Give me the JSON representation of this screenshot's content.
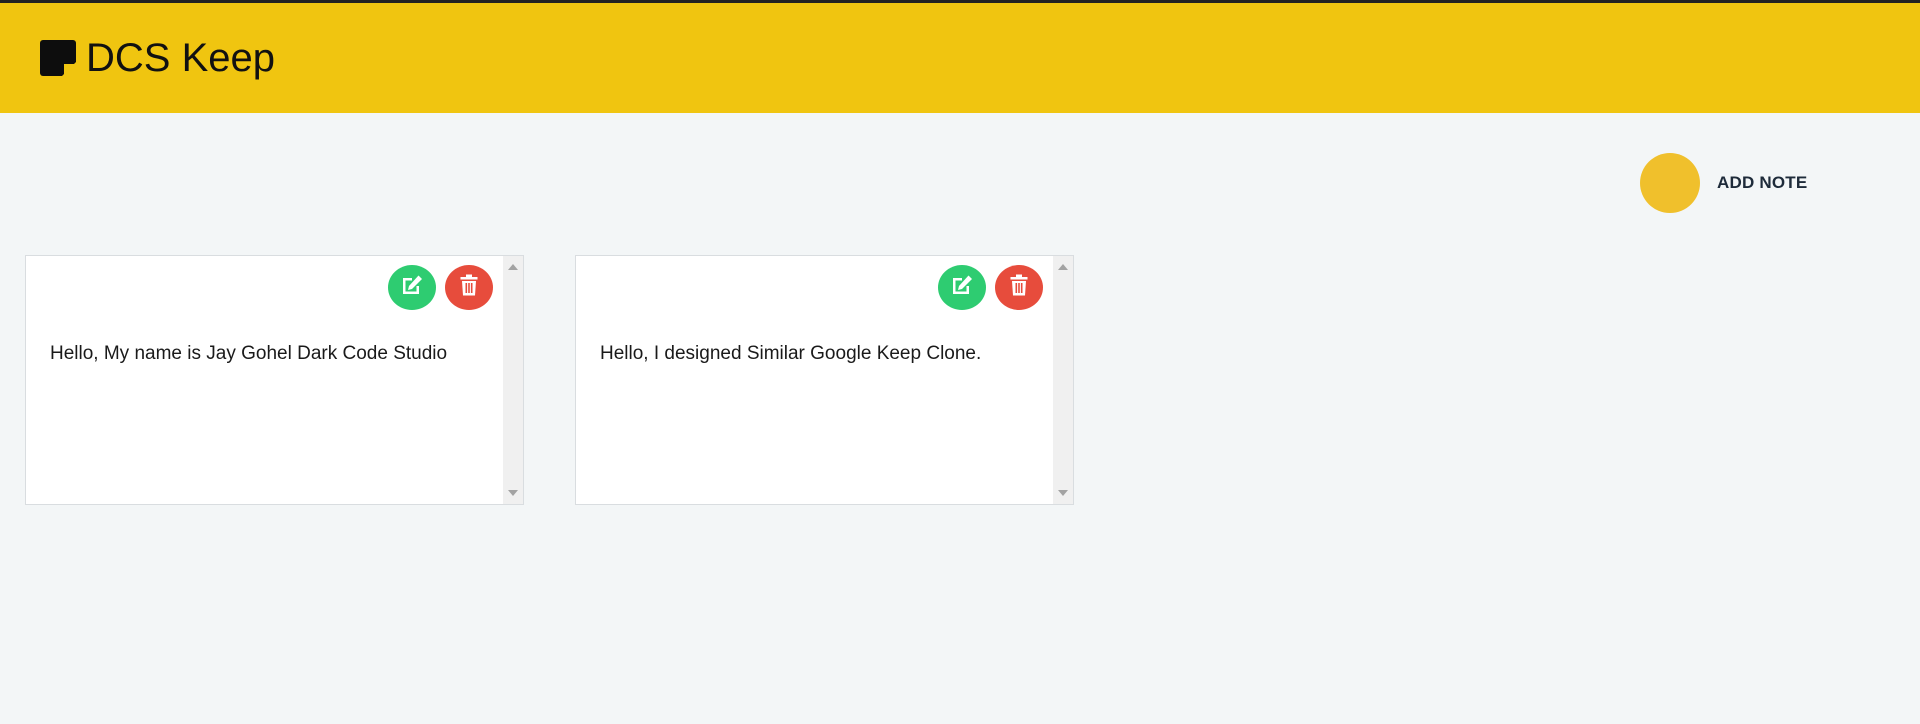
{
  "header": {
    "title": "DCS Keep",
    "logo_icon": "sticky-note-icon",
    "background": "#f0c510"
  },
  "add_note": {
    "label": "ADD NOTE",
    "circle_color": "#f0c02c"
  },
  "notes": [
    {
      "text": "Hello, My name is Jay Gohel Dark Code Studio",
      "edit_icon": "edit-icon",
      "delete_icon": "trash-icon"
    },
    {
      "text": "Hello, I designed Similar Google Keep Clone.",
      "edit_icon": "edit-icon",
      "delete_icon": "trash-icon"
    }
  ],
  "colors": {
    "edit": "#2ecc71",
    "delete": "#e74c3c",
    "page_background": "#f3f6f7"
  }
}
